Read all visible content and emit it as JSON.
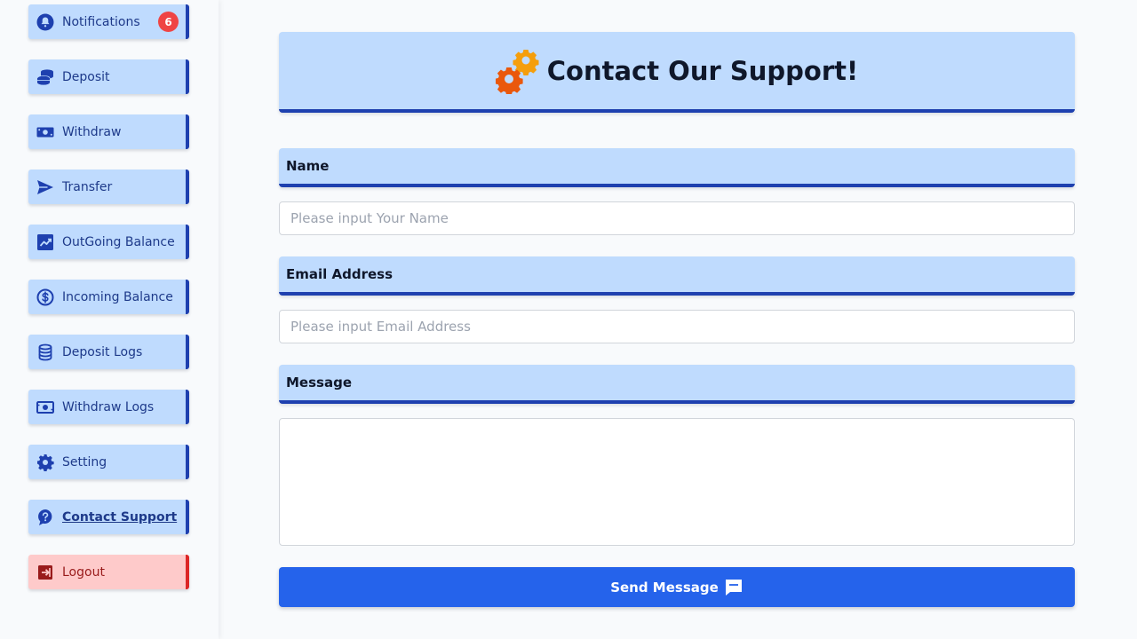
{
  "sidebar": {
    "items": [
      {
        "label": "Notifications",
        "icon": "bell-icon",
        "badge": "6"
      },
      {
        "label": "Deposit",
        "icon": "coins-icon"
      },
      {
        "label": "Withdraw",
        "icon": "money-bill-icon"
      },
      {
        "label": "Transfer",
        "icon": "paper-plane-icon"
      },
      {
        "label": "OutGoing Balance",
        "icon": "chart-line-icon"
      },
      {
        "label": "Incoming Balance",
        "icon": "dollar-circle-icon"
      },
      {
        "label": "Deposit Logs",
        "icon": "database-icon"
      },
      {
        "label": "Withdraw Logs",
        "icon": "money-bill-wave-icon"
      },
      {
        "label": "Setting",
        "icon": "gear-icon"
      },
      {
        "label": "Contact Support",
        "icon": "question-icon",
        "active": true
      },
      {
        "label": "Logout",
        "icon": "sign-out-icon"
      }
    ]
  },
  "header": {
    "title": "Contact Our Support!",
    "icon": "gears-icon"
  },
  "form": {
    "name_label": "Name",
    "name_placeholder": "Please input Your Name",
    "email_label": "Email Address",
    "email_placeholder": "Please input Email Address",
    "message_label": "Message",
    "submit_label": "Send Message"
  },
  "colors": {
    "accent": "#2563eb",
    "panel": "#bfdbfe",
    "border": "#1e40af",
    "logout": "#fecaca",
    "badge": "#ef4444"
  }
}
